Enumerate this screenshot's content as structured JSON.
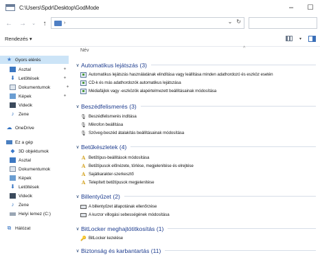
{
  "window": {
    "path": "C:\\Users\\Spdr\\Desktop\\GodMode",
    "minimize": "–",
    "maximize": "☐"
  },
  "address": {
    "chevron": "›",
    "dropdown": "⌄",
    "refresh": "↻"
  },
  "toolbar": {
    "organize": "Rendezés ▾"
  },
  "sidebar": {
    "quick_access": "Gyors elérés",
    "quick_items": [
      "Asztal",
      "Letöltések",
      "Dokumentumok",
      "Képek",
      "Videók",
      "Zene"
    ],
    "onedrive": "OneDrive",
    "this_pc": "Ez a gép",
    "pc_items": [
      "3D objektumok",
      "Asztal",
      "Dokumentumok",
      "Képek",
      "Letöltések",
      "Videók",
      "Zene",
      "Helyi lemez (C:)"
    ],
    "network": "Hálózat"
  },
  "content": {
    "column_header": "Név",
    "groups": [
      {
        "title": "Automatikus lejátszás (3)",
        "items": [
          "Automatikus lejátszás használatának elindítása vagy leállítása minden adathordozó és eszköz esetén",
          "CD-k és más adathordozók automatikus lejátszása",
          "Médiafájlok vagy -eszközök alapértelmezett beállításainak módosítása"
        ]
      },
      {
        "title": "Beszédfelismerés (3)",
        "items": [
          "Beszédfelismerés indítása",
          "Mikrofon beállítása",
          "Szöveg-beszéd átalakítás beállításainak módosítása"
        ]
      },
      {
        "title": "Betűkészletek (4)",
        "items": [
          "Betűtípus-beállítások módosítása",
          "Betűtípusok előnézete, törlése, megjelenítése és elrejtése",
          "Sajátkarakter-szerkesztő",
          "Telepített betűtípusok megjelenítése"
        ]
      },
      {
        "title": "Billentyűzet (2)",
        "items": [
          "A billentyűzet állapotának ellenőrzése",
          "A kurzor villogási sebességének módosítása"
        ]
      },
      {
        "title": "BitLocker meghajtótitkosítás (1)",
        "items": [
          "BitLocker kezelése"
        ]
      },
      {
        "title": "Biztonság és karbantartás (11)",
        "items": []
      }
    ]
  }
}
